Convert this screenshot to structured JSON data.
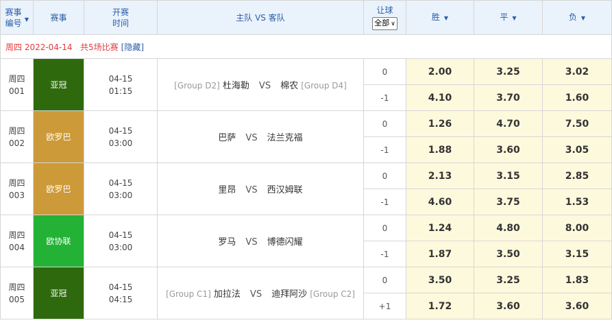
{
  "header": {
    "col_num": "赛事编号",
    "col_league": "赛事",
    "col_time": "开赛时间",
    "col_teams": "主队 VS 客队",
    "col_handicap": "让球",
    "handicap_select": "全部",
    "col_win": "胜",
    "col_draw": "平",
    "col_lose": "负"
  },
  "date_bar": {
    "text": "周四 2022-04-14   共5场比赛",
    "hide_label": "[隐藏]"
  },
  "vs_label": "VS",
  "colors": {
    "header_bg": "#eaf3fb",
    "odds_bg": "#fdf9dd",
    "date_red": "#e4393c",
    "link_blue": "#2a5da8"
  },
  "matches": [
    {
      "day": "周四",
      "no": "001",
      "league": "亚冠",
      "league_color": "#2e6a0d",
      "date": "04-15",
      "time": "01:15",
      "home_group": "[Group D2]",
      "home": "杜海勒",
      "away": "棉农",
      "away_group": "[Group D4]",
      "rows": [
        {
          "hcp": "0",
          "win": "2.00",
          "draw": "3.25",
          "lose": "3.02"
        },
        {
          "hcp": "-1",
          "win": "4.10",
          "draw": "3.70",
          "lose": "1.60"
        }
      ]
    },
    {
      "day": "周四",
      "no": "002",
      "league": "欧罗巴",
      "league_color": "#cc9a39",
      "date": "04-15",
      "time": "03:00",
      "home_group": "",
      "home": "巴萨",
      "away": "法兰克福",
      "away_group": "",
      "rows": [
        {
          "hcp": "0",
          "win": "1.26",
          "draw": "4.70",
          "lose": "7.50"
        },
        {
          "hcp": "-1",
          "win": "1.88",
          "draw": "3.60",
          "lose": "3.05"
        }
      ]
    },
    {
      "day": "周四",
      "no": "003",
      "league": "欧罗巴",
      "league_color": "#cc9a39",
      "date": "04-15",
      "time": "03:00",
      "home_group": "",
      "home": "里昂",
      "away": "西汉姆联",
      "away_group": "",
      "rows": [
        {
          "hcp": "0",
          "win": "2.13",
          "draw": "3.15",
          "lose": "2.85"
        },
        {
          "hcp": "-1",
          "win": "4.60",
          "draw": "3.75",
          "lose": "1.53"
        }
      ]
    },
    {
      "day": "周四",
      "no": "004",
      "league": "欧协联",
      "league_color": "#23b235",
      "date": "04-15",
      "time": "03:00",
      "home_group": "",
      "home": "罗马",
      "away": "博德闪耀",
      "away_group": "",
      "rows": [
        {
          "hcp": "0",
          "win": "1.24",
          "draw": "4.80",
          "lose": "8.00"
        },
        {
          "hcp": "-1",
          "win": "1.87",
          "draw": "3.50",
          "lose": "3.15"
        }
      ]
    },
    {
      "day": "周四",
      "no": "005",
      "league": "亚冠",
      "league_color": "#2e6a0d",
      "date": "04-15",
      "time": "04:15",
      "home_group": "[Group C1]",
      "home": "加拉法",
      "away": "迪拜阿沙",
      "away_group": "[Group C2]",
      "rows": [
        {
          "hcp": "0",
          "win": "3.50",
          "draw": "3.25",
          "lose": "1.83"
        },
        {
          "hcp": "+1",
          "win": "1.72",
          "draw": "3.60",
          "lose": "3.60"
        }
      ]
    }
  ]
}
